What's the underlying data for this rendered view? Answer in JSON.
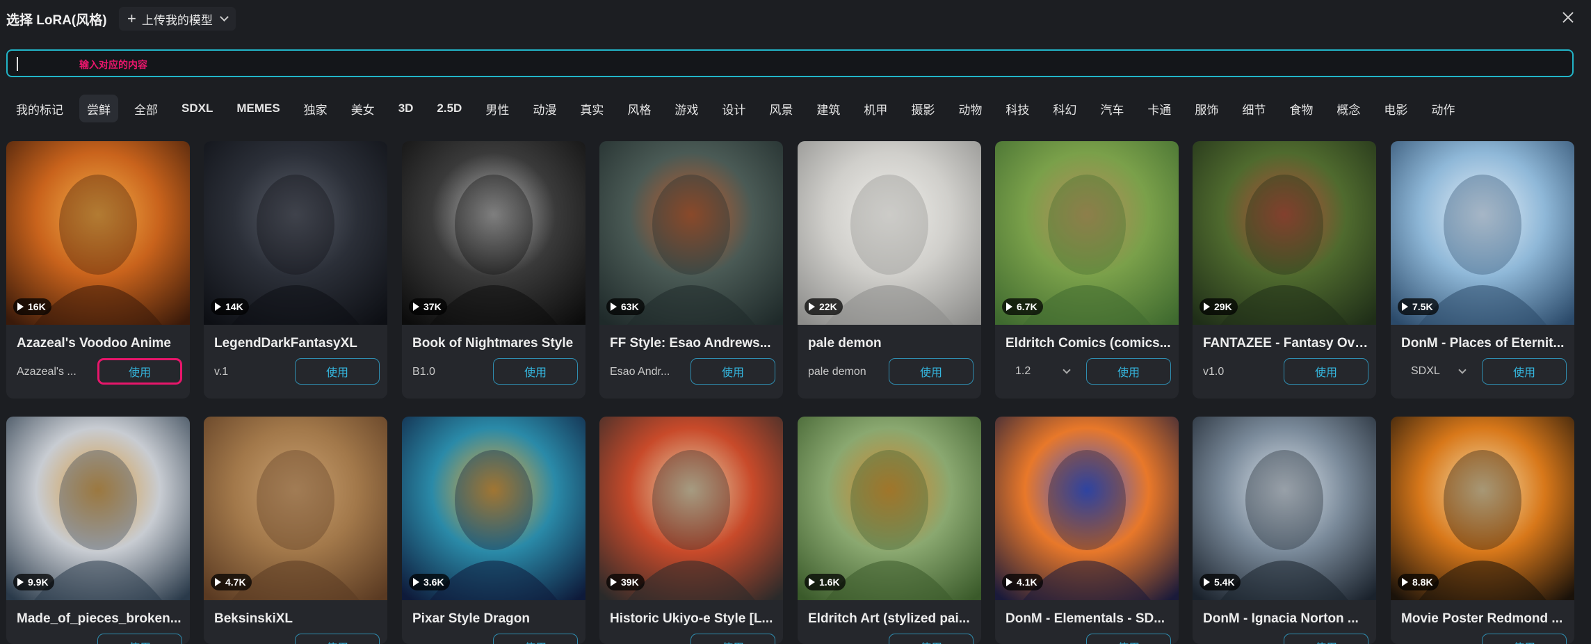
{
  "header": {
    "title": "选择 LoRA(风格)",
    "upload_label": "上传我的模型"
  },
  "search": {
    "placeholder": "输入对应的内容"
  },
  "tags": [
    "我的标记",
    "尝鲜",
    "全部",
    "SDXL",
    "MEMES",
    "独家",
    "美女",
    "3D",
    "2.5D",
    "男性",
    "动漫",
    "真实",
    "风格",
    "游戏",
    "设计",
    "风景",
    "建筑",
    "机甲",
    "摄影",
    "动物",
    "科技",
    "科幻",
    "汽车",
    "卡通",
    "服饰",
    "细节",
    "食物",
    "概念",
    "电影",
    "动作"
  ],
  "active_tag": "尝鲜",
  "cards": [
    {
      "name": "Azazeal's Voodoo Anime",
      "views": "16K",
      "version": "Azazeal's ...",
      "version_dropdown": false,
      "use": "使用",
      "palette": [
        "#3a1a0a",
        "#c9631c",
        "#f4b04a"
      ]
    },
    {
      "name": "LegendDarkFantasyXL",
      "views": "14K",
      "version": "v.1",
      "version_dropdown": false,
      "use": "使用",
      "palette": [
        "#0d0f14",
        "#2b2f38",
        "#5a5f6a"
      ]
    },
    {
      "name": "Book of Nightmares Style",
      "views": "37K",
      "version": "B1.0",
      "version_dropdown": false,
      "use": "使用",
      "palette": [
        "#0c0c0c",
        "#3a3a3a",
        "#bdbdbd"
      ]
    },
    {
      "name": "FF Style: Esao Andrews...",
      "views": "63K",
      "version": "Esao Andr...",
      "version_dropdown": false,
      "use": "使用",
      "palette": [
        "#1f2a2a",
        "#4a5a55",
        "#c35a2a"
      ]
    },
    {
      "name": "pale demon",
      "views": "22K",
      "version": "pale demon",
      "version_dropdown": false,
      "use": "使用",
      "palette": [
        "#8c8c8a",
        "#d0cfcb",
        "#efeeea"
      ]
    },
    {
      "name": "Eldritch Comics (comics...",
      "views": "6.7K",
      "version": "1.2",
      "version_dropdown": true,
      "use": "使用",
      "palette": [
        "#3f6a2f",
        "#7aa04a",
        "#b88a5a"
      ]
    },
    {
      "name": "FANTAZEE - Fantasy Ove...",
      "views": "29K",
      "version": "v1.0",
      "version_dropdown": false,
      "use": "使用",
      "palette": [
        "#1f2e18",
        "#4f6a2e",
        "#b84a3a"
      ]
    },
    {
      "name": "DonM - Places of Eternit...",
      "views": "7.5K",
      "version": "SDXL",
      "version_dropdown": true,
      "use": "使用",
      "palette": [
        "#2b4a6a",
        "#8fb8d8",
        "#e8f0f8"
      ]
    },
    {
      "name": "Made_of_pieces_broken...",
      "views": "9.9K",
      "version": "",
      "version_dropdown": false,
      "use": "使用",
      "palette": [
        "#2a3a4a",
        "#c8ccd2",
        "#d89a3a"
      ]
    },
    {
      "name": "BeksinskiXL",
      "views": "4.7K",
      "version": "",
      "version_dropdown": false,
      "use": "使用",
      "palette": [
        "#5a3a22",
        "#a2784a",
        "#c9a070"
      ]
    },
    {
      "name": "Pixar Style Dragon",
      "views": "3.6K",
      "version": "",
      "version_dropdown": false,
      "use": "使用",
      "palette": [
        "#0e1a3a",
        "#2a8aa8",
        "#f0a830"
      ]
    },
    {
      "name": "Historic Ukiyo-e Style [L...",
      "views": "39K",
      "version": "",
      "version_dropdown": false,
      "use": "使用",
      "palette": [
        "#2a2a2a",
        "#c84a2a",
        "#e8d8b0"
      ]
    },
    {
      "name": "Eldritch Art (stylized pai...",
      "views": "1.6K",
      "version": "",
      "version_dropdown": false,
      "use": "使用",
      "palette": [
        "#3a5a2a",
        "#8aa870",
        "#d8852a"
      ]
    },
    {
      "name": "DonM - Elementals - SD...",
      "views": "4.1K",
      "version": "",
      "version_dropdown": false,
      "use": "使用",
      "palette": [
        "#1a1a3a",
        "#e8782a",
        "#3a5ad8"
      ]
    },
    {
      "name": "DonM - Ignacia Norton ...",
      "views": "5.4K",
      "version": "",
      "version_dropdown": false,
      "use": "使用",
      "palette": [
        "#1a222c",
        "#7a8a9a",
        "#dce4ec"
      ]
    },
    {
      "name": "Movie Poster Redmond ...",
      "views": "8.8K",
      "version": "",
      "version_dropdown": false,
      "use": "使用",
      "palette": [
        "#1a120a",
        "#d8781a",
        "#f4e0b0"
      ]
    }
  ],
  "highlighted_use_index": 0
}
